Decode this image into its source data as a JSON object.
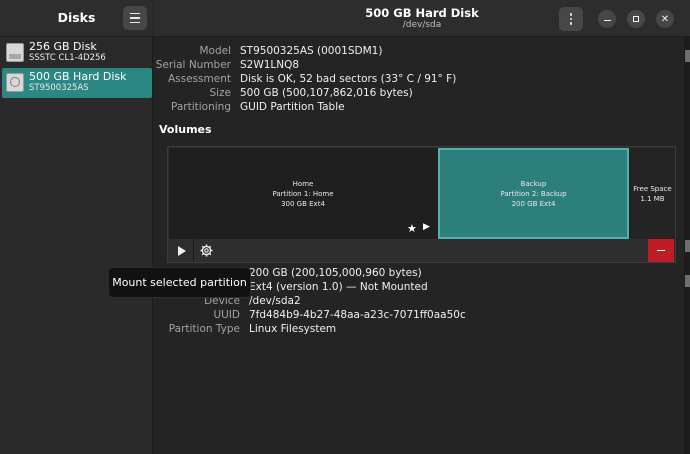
{
  "sidebar": {
    "title": "Disks",
    "disks": [
      {
        "name": "256 GB Disk",
        "model": "SSSTC CL1-4D256",
        "icon": "ssd-drive-icon",
        "selected": false
      },
      {
        "name": "500 GB Hard Disk",
        "model": "ST9500325AS",
        "icon": "hard-disk-icon",
        "selected": true
      }
    ]
  },
  "header": {
    "title": "500 GB Hard Disk",
    "subtitle": "/dev/sda"
  },
  "disk_info": {
    "model_label": "Model",
    "model": "ST9500325AS (0001SDM1)",
    "serial_label": "Serial Number",
    "serial": "S2W1LNQ8",
    "assessment_label": "Assessment",
    "assessment": "Disk is OK, 52 bad sectors (33° C / 91° F)",
    "size_label": "Size",
    "size": "500 GB (500,107,862,016 bytes)",
    "partitioning_label": "Partitioning",
    "partitioning": "GUID Partition Table"
  },
  "volumes": {
    "title": "Volumes",
    "partitions": [
      {
        "name": "Home",
        "line2": "Partition 1: Home",
        "line3": "300 GB Ext4",
        "selected": false
      },
      {
        "name": "Backup",
        "line2": "Partition 2: Backup",
        "line3": "200 GB Ext4",
        "selected": true
      },
      {
        "name": "Free Space",
        "line2": "1.1 MB",
        "selected": false
      }
    ]
  },
  "tooltip": "Mount selected partition",
  "partition_info": {
    "size": "200 GB (200,105,000,960 bytes)",
    "contents": "Ext4 (version 1.0) — Not Mounted",
    "device_label": "Device",
    "device": "/dev/sda2",
    "uuid_label": "UUID",
    "uuid": "7fd484b9-4b27-48aa-a23c-7071ff0aa50c",
    "type_label": "Partition Type",
    "type": "Linux Filesystem"
  },
  "colors": {
    "accent": "#2b8782",
    "selected_partition": "#2d7f7b",
    "delete": "#c01c28"
  }
}
